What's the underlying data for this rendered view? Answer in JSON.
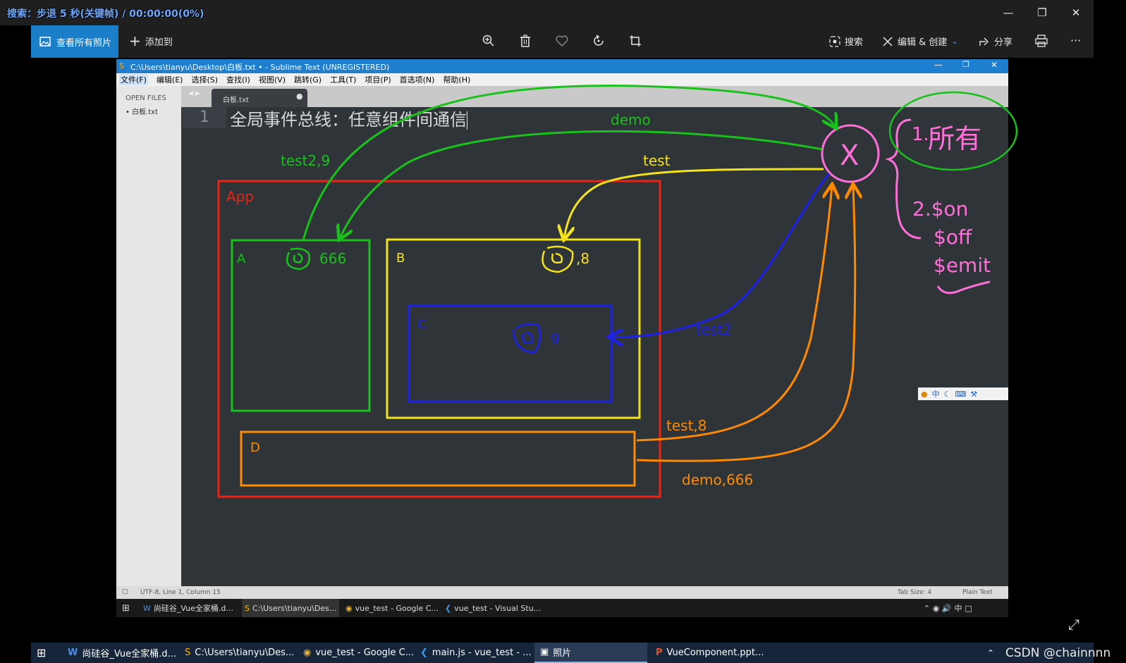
{
  "top_overlay": {
    "search_status": "搜索：步退 5 秒(关键帧) / 00:00:00(0%)"
  },
  "photos": {
    "view_all_label": "查看所有照片",
    "add_to_label": "添加到",
    "search_label": "搜索",
    "edit_create_label": "编辑 & 创建",
    "share_label": "分享",
    "more_label": "···"
  },
  "sublime": {
    "title": "C:\\Users\\tianyu\\Desktop\\白板.txt • - Sublime Text (UNREGISTERED)",
    "menu": [
      "文件(F)",
      "编辑(E)",
      "选择(S)",
      "查找(I)",
      "视图(V)",
      "跳转(G)",
      "工具(T)",
      "项目(P)",
      "首选项(N)",
      "帮助(H)"
    ],
    "open_files_label": "OPEN FILES",
    "open_file": "白板.txt",
    "tab_name": "白板.txt",
    "line_number": "1",
    "code_line": "全局事件总线：任意组件间通信",
    "status_left": "UTF-8, Line 1, Column 15",
    "status_tab": "Tab Size: 4",
    "status_syntax": "Plain Text",
    "taskbar_items": [
      "尚硅谷_Vue全家桶.d...",
      "C:\\Users\\tianyu\\Des...",
      "vue_test - Google C...",
      "vue_test - Visual Stu..."
    ],
    "ime_label": "中"
  },
  "annotations": {
    "box_labels": {
      "app": "App",
      "a": "A",
      "b": "B",
      "c": "C",
      "d": "D"
    },
    "values": {
      "a": "666",
      "b": ",8",
      "c": "9"
    },
    "arrow_labels": {
      "demo": "demo",
      "test": "test",
      "test2_9": "test2,9",
      "test2": "test2",
      "test_8": "test,8",
      "demo_666": "demo,666"
    },
    "bus_symbol": "X",
    "notes": {
      "n1": "1.",
      "n1_word": "所有",
      "n2": "2.$on",
      "off": "$off",
      "emit": "$emit"
    }
  },
  "colors": {
    "green": "#19c11b",
    "yellow": "#f4e21a",
    "blue": "#1e22e8",
    "orange": "#ff8a00",
    "red": "#ee2211",
    "pink": "#ff6fd8"
  },
  "taskbar": {
    "items": [
      "尚硅谷_Vue全家桶.d...",
      "C:\\Users\\tianyu\\Des...",
      "vue_test - Google C...",
      "main.js - vue_test - ...",
      "照片",
      "VueComponent.ppt..."
    ],
    "watermark": "CSDN @chainnnn"
  }
}
